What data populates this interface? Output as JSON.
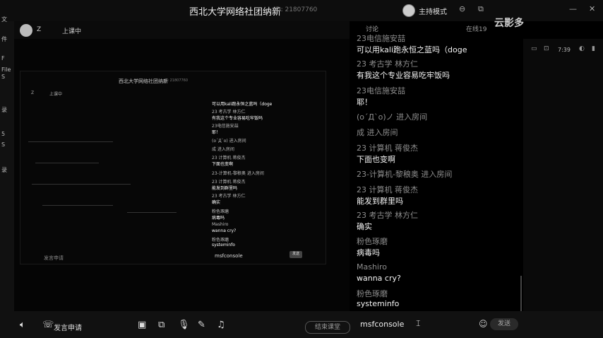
{
  "window": {
    "title": "西北大学网络社团纳新",
    "room_id": "ID: 21807760",
    "host_mode": "主持模式",
    "controls": [
      "⊖",
      "⧉",
      "—",
      "✕"
    ],
    "brand": "云影多"
  },
  "topbar": {
    "user": "Z",
    "status": "上课中"
  },
  "chat_header": {
    "tab": "讨论",
    "online": "在线19"
  },
  "sidebar": [
    "文",
    "件",
    "F",
    "File",
    "S",
    "录",
    "5",
    "S",
    "录"
  ],
  "chat": [
    {
      "name": "23电信施安喆",
      "text": "可以用kali跑永恒之蓝吗（doge"
    },
    {
      "name": "23 考古学 林方仁",
      "text": "有我这个专业容易吃牢饭吗"
    },
    {
      "name": "23电信施安喆",
      "text": "耶！"
    },
    {
      "name": "(o´Д`o)ノ 进入房间",
      "text": ""
    },
    {
      "name": "成 进入房间",
      "text": ""
    },
    {
      "name": "23 计算机 蒋俊杰",
      "text": "下面也变啊"
    },
    {
      "name": "23-计算机-黎稂奥 进入房间",
      "text": ""
    },
    {
      "name": "23 计算机 蒋俊杰",
      "text": "能发到群里吗"
    },
    {
      "name": "23 考古学 林方仁",
      "text": "确实"
    },
    {
      "name": "粉色琢磨",
      "text": "病毒吗"
    },
    {
      "name": "Mashiro",
      "text": "wanna cry?"
    },
    {
      "name": "粉色琢磨",
      "text": "systeminfo"
    }
  ],
  "nested": {
    "title": "西北大学网络社团纳新",
    "room_id": "ID: 21807760",
    "user": "Z",
    "status": "上课中",
    "lines": [
      "可以用kali跑永恒之蓝吗（doge",
      "23 考古学 林方仁",
      "有我这个专业容易吃牢饭吗",
      "23电信施安喆",
      "耶！",
      "(o´Д`o) 进入房间",
      "成 进入房间",
      "23 计算机 蒋俊杰",
      "下面也变啊",
      "23-计算机-黎稂奥 进入房间",
      "23 计算机 蒋俊杰",
      "能发到群里吗",
      "23 考古学 林方仁",
      "确实",
      "粉色琢磨",
      "病毒吗",
      "Mashiro",
      "wanna cry?",
      "粉色琢磨",
      "systeminfo"
    ],
    "input": "msfconsole",
    "send": "发送",
    "speak": "发言申请"
  },
  "right_panel": {
    "time": "7:39"
  },
  "bottom": {
    "speak_label": "发言申请",
    "end_class": "结束课堂",
    "input_value": "msfconsole",
    "send": "发送"
  },
  "icons": {
    "speaker": "speaker-icon",
    "phone": "phone-icon",
    "camera": "camera-off-icon",
    "screen": "screen-share-icon",
    "mic": "microphone-icon",
    "edit": "edit-icon",
    "music": "music-icon",
    "emoji": "emoji-icon"
  }
}
